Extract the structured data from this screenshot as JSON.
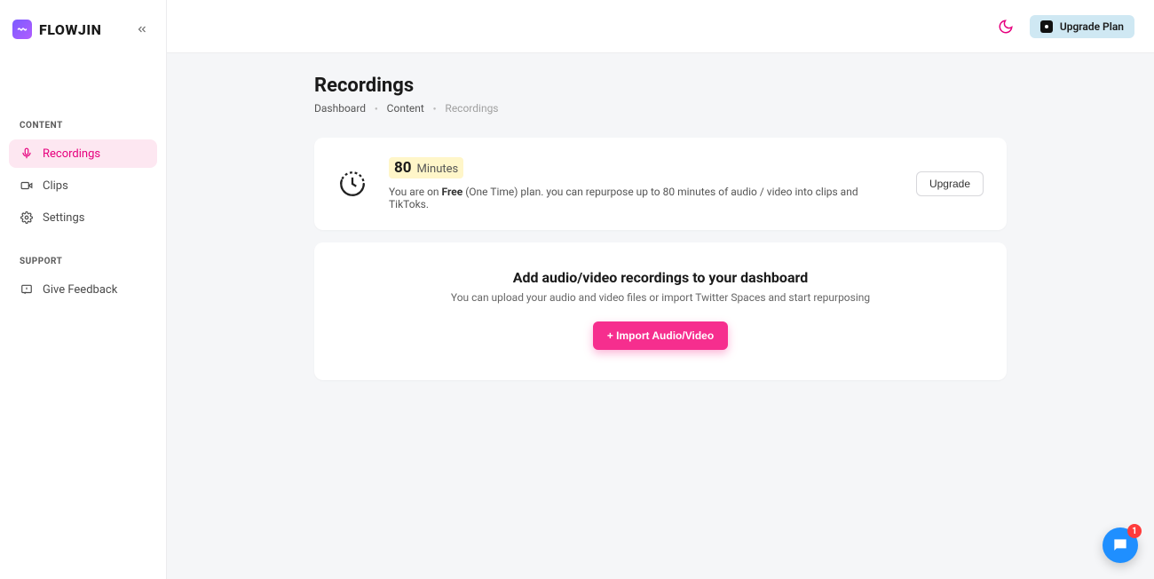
{
  "brand": {
    "name": "FLOWJIN"
  },
  "sidebar": {
    "sections": {
      "content": {
        "label": "CONTENT"
      },
      "support": {
        "label": "SUPPORT"
      }
    },
    "items": [
      {
        "label": "Recordings"
      },
      {
        "label": "Clips"
      },
      {
        "label": "Settings"
      },
      {
        "label": "Give Feedback"
      }
    ]
  },
  "header": {
    "upgrade_plan": "Upgrade Plan"
  },
  "page": {
    "title": "Recordings",
    "breadcrumb": [
      "Dashboard",
      "Content",
      "Recordings"
    ]
  },
  "plan": {
    "minutes": "80",
    "minutes_label": "Minutes",
    "desc_prefix": "You are on ",
    "desc_bold": "Free",
    "desc_suffix": " (One Time) plan. you can repurpose up to 80 minutes of audio / video into clips and TikToks.",
    "upgrade_label": "Upgrade"
  },
  "empty": {
    "title": "Add audio/video recordings to your dashboard",
    "subtitle": "You can upload your audio and video files or import Twitter Spaces and start repurposing",
    "import_label": "+ Import Audio/Video"
  },
  "chat": {
    "badge": "1"
  }
}
